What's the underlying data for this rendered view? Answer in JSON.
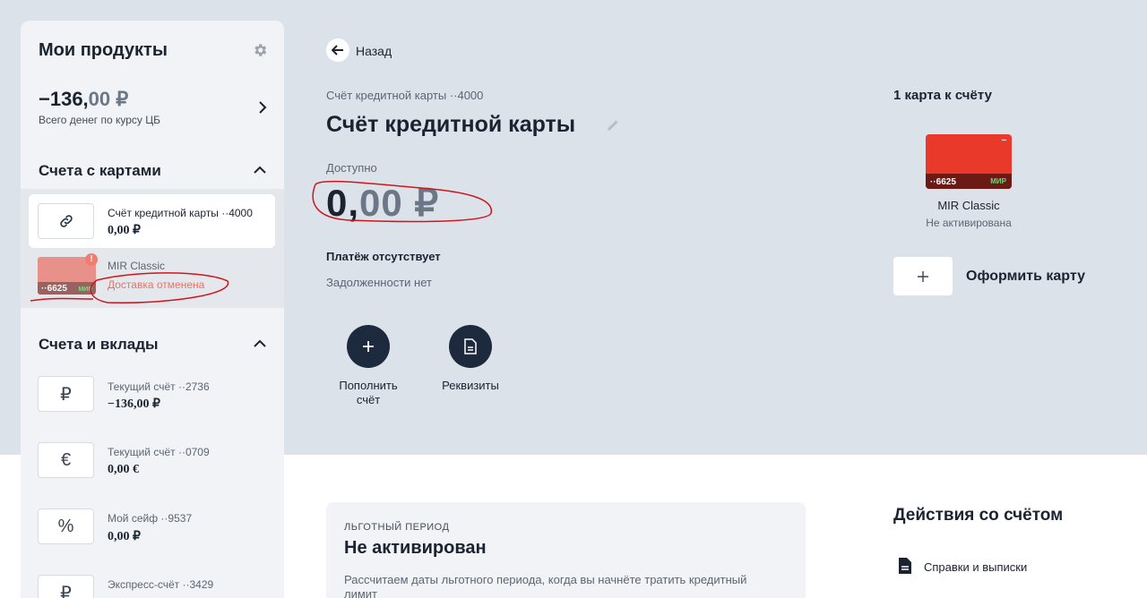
{
  "sidebar": {
    "title": "Мои продукты",
    "total_int": "−136,",
    "total_dec": "00 ₽",
    "total_caption": "Всего денег по курсу ЦБ",
    "cards_section": "Счета с картами",
    "deposits_section": "Счета и вклады",
    "credit_account": {
      "title": "Счёт кредитной карты ··4000",
      "amount": "0,00 ₽",
      "icon": "link-icon"
    },
    "mir_card": {
      "number": "··6625",
      "brand": "МИР",
      "title": "MIR Classic",
      "status": "Доставка отменена",
      "alert": "!"
    },
    "accounts": [
      {
        "title": "Текущий счёт ··2736",
        "amount": "−136,00 ₽",
        "icon": "₽"
      },
      {
        "title": "Текущий счёт ··0709",
        "amount": "0,00 €",
        "icon": "€"
      },
      {
        "title": "Мой сейф ··9537",
        "amount": "0,00 ₽",
        "icon": "%"
      },
      {
        "title": "Экспресс-счёт ··3429",
        "amount": "",
        "icon": "₽"
      }
    ]
  },
  "main": {
    "back_label": "Назад",
    "account_subtitle": "Счёт кредитной карты ··4000",
    "account_title": "Счёт кредитной карты",
    "available_label": "Доступно",
    "available_int": "0,",
    "available_dec": "00 ₽",
    "payment_label": "Платёж отсутствует",
    "debt_label": "Задолженности нет",
    "topup_label_1": "Пополнить",
    "topup_label_2": "счёт",
    "requisites_label": "Реквизиты"
  },
  "right": {
    "cards_count": "1 карта к счёту",
    "card_number": "··6625",
    "card_brand": "МИР",
    "card_name": "MIR Classic",
    "card_status": "Не активирована",
    "order_label": "Оформить карту"
  },
  "grace": {
    "overline": "ЛЬГОТНЫЙ ПЕРИОД",
    "title": "Не активирован",
    "text": "Рассчитаем даты льготного периода, когда вы начнёте тратить кредитный лимит"
  },
  "actions": {
    "title": "Действия со счётом",
    "certificates_label": "Справки и выписки"
  },
  "colors": {
    "page_bg": "#dce2ea",
    "dark_button": "#1d2a3d",
    "card_red": "#e8392a",
    "warning": "#e3746b",
    "annotation": "#d0151b"
  }
}
